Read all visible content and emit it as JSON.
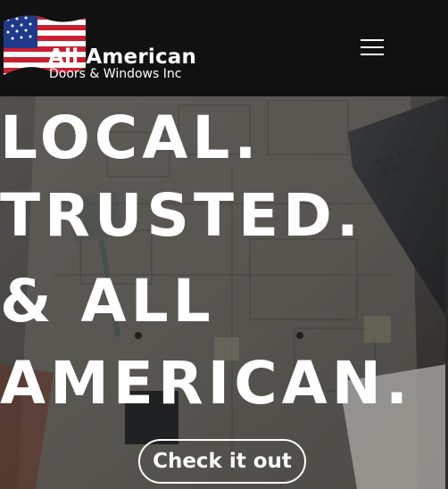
{
  "header": {
    "logo_title": "All American",
    "logo_subtitle": "Doors & Windows Inc",
    "menu_icon": "hamburger-menu-icon"
  },
  "hero": {
    "headline_lines": [
      "LOCAL.",
      "TRUSTED.",
      "& ALL",
      "AMERICAN."
    ],
    "cta_label": "Check it out"
  },
  "colors": {
    "header_bg": "#111111",
    "text": "#ffffff",
    "flag_red": "#c8202f",
    "flag_blue": "#1f3a8a"
  }
}
